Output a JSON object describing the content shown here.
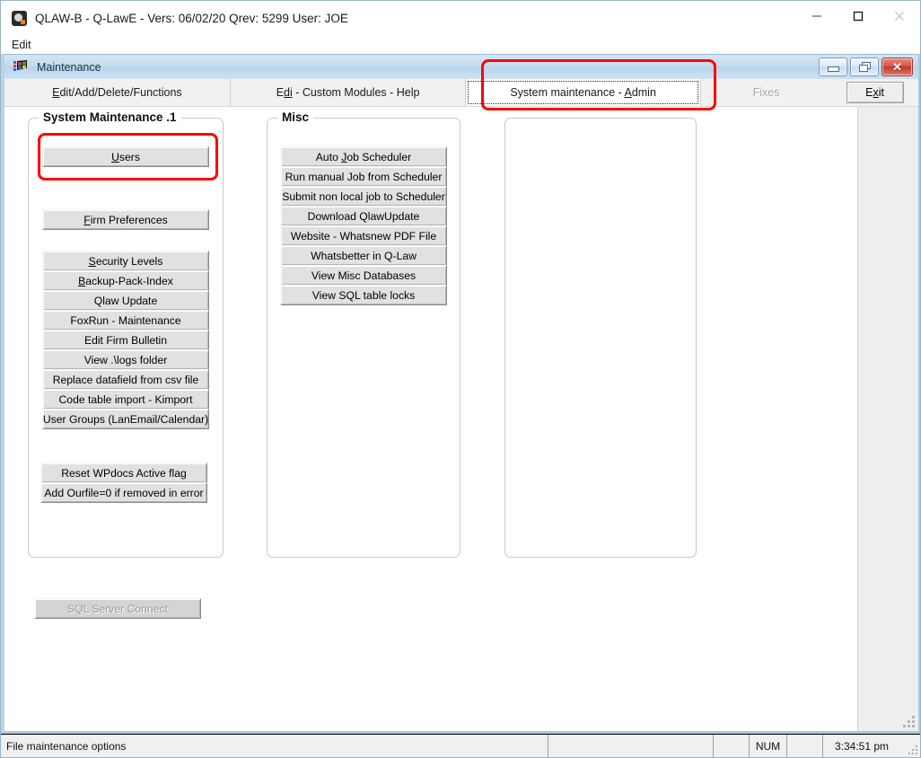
{
  "app": {
    "title": "QLAW-B - Q-LawE - Vers: 06/02/20 Qrev: 5299 User: JOE",
    "icon": "qlaw-app-icon",
    "menu": [
      {
        "label": "Edit"
      }
    ],
    "window_controls": {
      "minimize": "minimize-icon",
      "maximize": "maximize-icon",
      "close": "close-icon"
    }
  },
  "maintenance_window": {
    "title": "Maintenance",
    "icon": "maintenance-window-icon",
    "controls": {
      "minimize": "minimize-icon",
      "restore": "restore-icon",
      "close": "close-icon"
    }
  },
  "tabs": [
    {
      "label": "Edit/Add/Delete/Functions",
      "accel": "E",
      "selected": false,
      "enabled": true
    },
    {
      "label": "Edi - Custom Modules - Help",
      "accel": "di",
      "selected": false,
      "enabled": true
    },
    {
      "label": "System maintenance - Admin",
      "accel": "A",
      "selected": true,
      "enabled": true,
      "focused": true
    },
    {
      "label": "Fixes",
      "accel": "",
      "selected": false,
      "enabled": false
    }
  ],
  "exit_button": {
    "label": "Exit",
    "accel": "x"
  },
  "panels": {
    "system_maintenance": {
      "title": "System Maintenance .1",
      "groups": [
        {
          "buttons": [
            {
              "label": "Users",
              "accel": "U",
              "highlighted": true
            }
          ]
        },
        {
          "buttons": [
            {
              "label": "Firm Preferences",
              "accel": "F"
            }
          ]
        },
        {
          "buttons": [
            {
              "label": "Security Levels",
              "accel": "S"
            },
            {
              "label": "Backup-Pack-Index",
              "accel": "B"
            },
            {
              "label": "Qlaw Update",
              "accel": ""
            },
            {
              "label": "FoxRun - Maintenance",
              "accel": ""
            },
            {
              "label": "Edit Firm Bulletin",
              "accel": ""
            },
            {
              "label": "View .\\logs folder",
              "accel": ""
            },
            {
              "label": "Replace datafield from csv file",
              "accel": ""
            },
            {
              "label": "Code table import - Kimport",
              "accel": ""
            },
            {
              "label": "User Groups (LanEmail/Calendar)",
              "accel": ""
            }
          ]
        },
        {
          "buttons": [
            {
              "label": "Reset WPdocs Active flag",
              "accel": ""
            },
            {
              "label": "Add Ourfile=0 if removed in error",
              "accel": ""
            }
          ]
        }
      ]
    },
    "misc": {
      "title": "Misc",
      "buttons": [
        {
          "label": "Auto Job Scheduler",
          "accel": "J"
        },
        {
          "label": "Run manual Job from Scheduler",
          "accel": ""
        },
        {
          "label": "Submit non local job to Scheduler",
          "accel": ""
        },
        {
          "label": "Download QlawUpdate",
          "accel": ""
        },
        {
          "label": "Website - Whatsnew PDF File",
          "accel": ""
        },
        {
          "label": "Whatsbetter in Q-Law",
          "accel": ""
        },
        {
          "label": "View Misc Databases",
          "accel": ""
        },
        {
          "label": "View SQL table locks",
          "accel": ""
        }
      ]
    },
    "third": {
      "title": "",
      "buttons": []
    }
  },
  "sql_server_connect": {
    "label": "SQL Server Connect",
    "enabled": false
  },
  "statusbar": {
    "message": "File maintenance options",
    "cell_blank_1": "",
    "num_indicator": "NUM",
    "cell_blank_2": "",
    "time": "3:34:51 pm"
  },
  "annotations": {
    "highlight_color": "#ff0000",
    "boxes": [
      {
        "target": "tab-system-maintenance-admin"
      },
      {
        "target": "users-button"
      }
    ]
  }
}
